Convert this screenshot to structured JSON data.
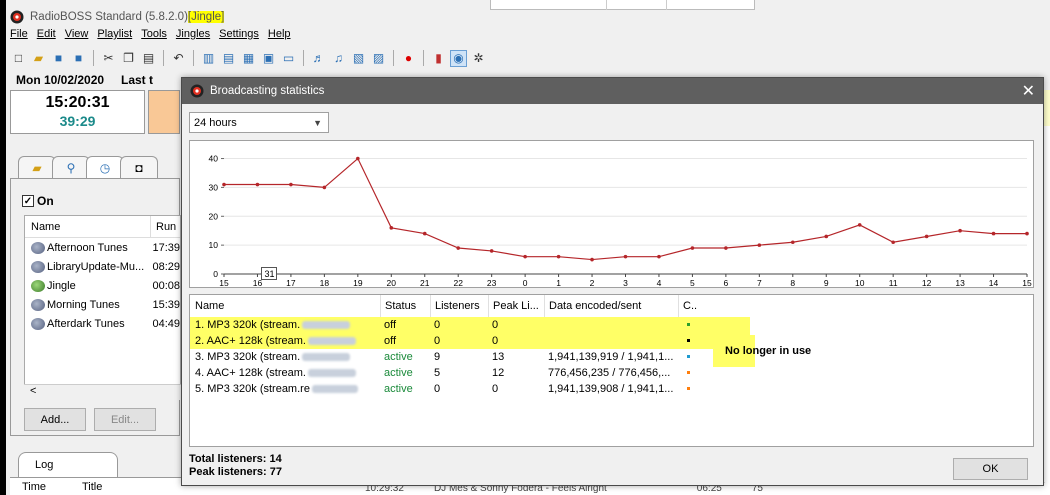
{
  "app": {
    "name": "RadioBOSS Standard (5.8.2.0)",
    "highlight": "[Jingle]"
  },
  "menu": [
    "File",
    "Edit",
    "View",
    "Playlist",
    "Tools",
    "Jingles",
    "Settings",
    "Help"
  ],
  "clock": {
    "date": "Mon 10/02/2020",
    "last_label": "Last t",
    "time": "15:20:31",
    "remaining": "39:29"
  },
  "scheduler": {
    "on_label": "On",
    "columns": [
      "Name",
      "Run"
    ],
    "items": [
      {
        "name": "Afternoon Tunes",
        "run": "17:39",
        "icon": "playlist-icon"
      },
      {
        "name": "LibraryUpdate-Mu...",
        "run": "08:29",
        "icon": "playlist-icon"
      },
      {
        "name": "Jingle",
        "run": "00:08",
        "icon": "jingle-icon"
      },
      {
        "name": "Morning Tunes",
        "run": "15:39",
        "icon": "playlist-icon"
      },
      {
        "name": "Afterdark Tunes",
        "run": "04:49",
        "icon": "playlist-icon"
      }
    ],
    "scroll_left": "<",
    "add_label": "Add...",
    "edit_label": "Edit..."
  },
  "log": {
    "tab_label": "Log",
    "col_time": "Time",
    "col_title": "Title"
  },
  "background_row": {
    "time": "10:29:32",
    "title": "DJ Mes & Sonny Fodera - Feels Alright",
    "duration": "06:25",
    "count": "75"
  },
  "dialog": {
    "title": "Broadcasting statistics",
    "period": "24 hours",
    "tooltip_value": "31",
    "table": {
      "columns": [
        "Name",
        "Status",
        "Listeners",
        "Peak Li...",
        "Data encoded/sent",
        "C.."
      ],
      "rows": [
        {
          "name": "1. MP3 320k (stream.",
          "status": "off",
          "listeners": "0",
          "peak": "0",
          "data": "",
          "color": "#2ca02c",
          "highlight": true
        },
        {
          "name": "2. AAC+ 128k (stream.",
          "status": "off",
          "listeners": "0",
          "peak": "0",
          "data": "",
          "color": "#000000",
          "highlight": true
        },
        {
          "name": "3. MP3 320k (stream.",
          "status": "active",
          "listeners": "9",
          "peak": "13",
          "data": "1,941,139,919 / 1,941,1...",
          "color": "#1f9bcf",
          "highlight": false
        },
        {
          "name": "4. AAC+ 128k (stream.",
          "status": "active",
          "listeners": "5",
          "peak": "12",
          "data": "776,456,235 / 776,456,...",
          "color": "#ff7f0e",
          "highlight": false
        },
        {
          "name": "5. MP3 320k (stream.re",
          "status": "active",
          "listeners": "0",
          "peak": "0",
          "data": "1,941,139,908 / 1,941,1...",
          "color": "#ff7f0e",
          "highlight": false
        }
      ]
    },
    "note": "No longer in use",
    "total_listeners": "Total listeners: 14",
    "peak_listeners": "Peak listeners: 77",
    "ok_label": "OK"
  },
  "chart_data": {
    "type": "line",
    "x": [
      "15",
      "16",
      "17",
      "18",
      "19",
      "20",
      "21",
      "22",
      "23",
      "0",
      "1",
      "2",
      "3",
      "4",
      "5",
      "6",
      "7",
      "8",
      "9",
      "10",
      "11",
      "12",
      "13",
      "14",
      "15"
    ],
    "series": [
      {
        "values": [
          31,
          31,
          31,
          30,
          40,
          16,
          14,
          9,
          8,
          6,
          6,
          5,
          6,
          6,
          9,
          9,
          10,
          11,
          13,
          17,
          11,
          13,
          15,
          14,
          14
        ]
      }
    ],
    "yticks": [
      0,
      10,
      20,
      30,
      40
    ],
    "ylim": [
      0,
      44
    ],
    "grid": "horizontal",
    "color": "#b5262a",
    "title": "",
    "xlabel": "",
    "ylabel": ""
  }
}
